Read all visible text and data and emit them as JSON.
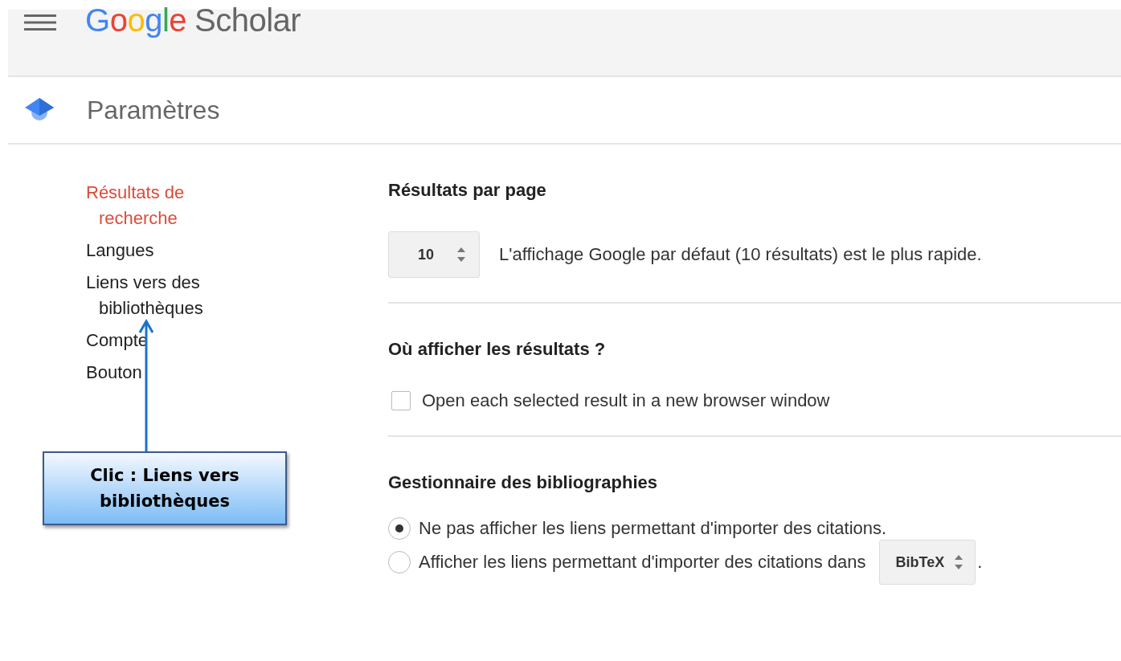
{
  "header": {
    "logo": [
      {
        "text": "G",
        "color": "#4285f4"
      },
      {
        "text": "o",
        "color": "#ea4335"
      },
      {
        "text": "o",
        "color": "#fbbc05"
      },
      {
        "text": "g",
        "color": "#4285f4"
      },
      {
        "text": "l",
        "color": "#34a853"
      },
      {
        "text": "e",
        "color": "#ea4335"
      }
    ],
    "product": "Scholar"
  },
  "page_title": "Paramètres",
  "sidebar": {
    "items": [
      {
        "label": "Résultats de recherche",
        "selected": true
      },
      {
        "label": "Langues",
        "selected": false
      },
      {
        "label": "Liens vers des bibliothèques",
        "selected": false
      },
      {
        "label": "Compte",
        "selected": false
      },
      {
        "label": "Bouton",
        "selected": false
      }
    ]
  },
  "sections": [
    {
      "kind": "spinner",
      "heading": "Résultats par page",
      "value": "10",
      "text": "L'affichage Google par défaut (10 résultats) est le plus rapide."
    },
    {
      "kind": "checkbox",
      "heading": "Où afficher les résultats ?",
      "label": "Open each selected result in a new browser window",
      "checked": false
    },
    {
      "kind": "radio",
      "heading": "Gestionnaire des bibliographies",
      "options": [
        {
          "label": "Ne pas afficher les liens permettant d'importer des citations.",
          "selected": true
        },
        {
          "label": "Afficher les liens permettant d'importer des citations dans",
          "selected": false,
          "select": "BibTeX",
          "suffix": "."
        }
      ]
    }
  ],
  "annotation": {
    "text": "Clic : Liens vers bibliothèques"
  }
}
